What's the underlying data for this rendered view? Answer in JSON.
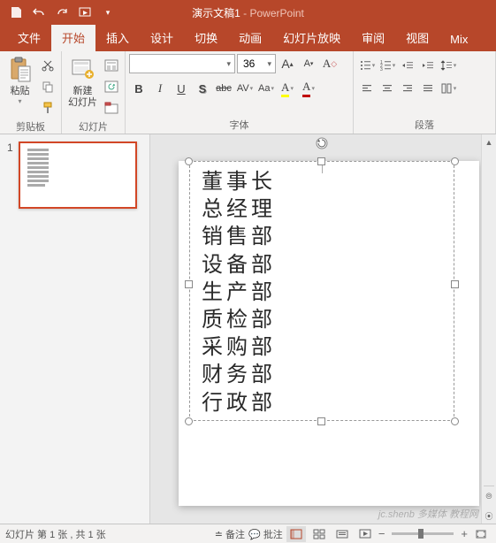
{
  "title": {
    "doc": "演示文稿1",
    "app": "PowerPoint"
  },
  "tabs": [
    {
      "label": "文件"
    },
    {
      "label": "开始"
    },
    {
      "label": "插入"
    },
    {
      "label": "设计"
    },
    {
      "label": "切换"
    },
    {
      "label": "动画"
    },
    {
      "label": "幻灯片放映"
    },
    {
      "label": "审阅"
    },
    {
      "label": "视图"
    },
    {
      "label": "Mix"
    }
  ],
  "ribbon": {
    "clipboard": {
      "paste": "粘贴",
      "label": "剪贴板"
    },
    "slides": {
      "new_slide": "新建\n幻灯片",
      "label": "幻灯片"
    },
    "font": {
      "label": "字体",
      "size": "36",
      "bold": "B",
      "italic": "I",
      "underline": "U",
      "shadow": "S",
      "strike": "abc",
      "spacing": "AV",
      "case": "Aa",
      "clear": "A",
      "color": "A"
    },
    "paragraph": {
      "label": "段落"
    }
  },
  "thumbnail": {
    "num": "1"
  },
  "textbox_lines": [
    "董事长",
    "总经理",
    "销售部",
    "设备部",
    "生产部",
    "质检部",
    "采购部",
    "财务部",
    "行政部"
  ],
  "status": {
    "slide_info": "幻灯片 第 1 张 , 共 1 张",
    "notes": "备注",
    "comments": "批注"
  },
  "watermark": "jc.shenb 多媒体 教程网"
}
